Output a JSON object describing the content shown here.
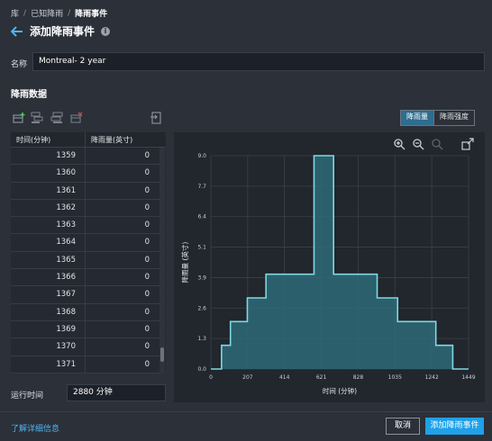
{
  "breadcrumb": [
    "库",
    "已知降雨",
    "降雨事件"
  ],
  "page_title": "添加降雨事件",
  "name_field": {
    "label": "名称",
    "value": "Montreal- 2 year"
  },
  "section_title": "降雨数据",
  "toggle": {
    "depth": "降雨量",
    "intensity": "降雨强度"
  },
  "table": {
    "headers": [
      "时间(分钟)",
      "降雨量(英寸)"
    ],
    "rows": [
      [
        "1359",
        "0"
      ],
      [
        "1360",
        "0"
      ],
      [
        "1361",
        "0"
      ],
      [
        "1362",
        "0"
      ],
      [
        "1363",
        "0"
      ],
      [
        "1364",
        "0"
      ],
      [
        "1365",
        "0"
      ],
      [
        "1366",
        "0"
      ],
      [
        "1367",
        "0"
      ],
      [
        "1368",
        "0"
      ],
      [
        "1369",
        "0"
      ],
      [
        "1370",
        "0"
      ],
      [
        "1371",
        "0"
      ]
    ]
  },
  "runtime": {
    "label": "运行时间",
    "value": "2880 分钟"
  },
  "footer": {
    "learn_more": "了解详细信息",
    "cancel": "取消",
    "add": "添加降雨事件"
  },
  "colors": {
    "accent": "#1ea1e8",
    "series_line": "#7fd8e0",
    "series_fill": "#2e6a78"
  },
  "chart_data": {
    "type": "area",
    "title": "",
    "xlabel": "时间 (分钟)",
    "ylabel": "降雨量 (英寸)",
    "xlim": [
      0,
      1449
    ],
    "ylim": [
      0,
      9.0
    ],
    "x_ticks": [
      "0",
      "207",
      "414",
      "621",
      "828",
      "1035",
      "1242",
      "1449"
    ],
    "y_ticks": [
      "0.0",
      "1.3",
      "2.6",
      "3.9",
      "5.1",
      "6.4",
      "7.7",
      "9.0"
    ],
    "grid": true,
    "step_points": [
      [
        0,
        0
      ],
      [
        60,
        0
      ],
      [
        60,
        1.0
      ],
      [
        110,
        1.0
      ],
      [
        110,
        2.0
      ],
      [
        205,
        2.0
      ],
      [
        205,
        3.0
      ],
      [
        310,
        3.0
      ],
      [
        310,
        4.0
      ],
      [
        580,
        4.0
      ],
      [
        580,
        9.0
      ],
      [
        690,
        9.0
      ],
      [
        690,
        4.0
      ],
      [
        935,
        4.0
      ],
      [
        935,
        3.0
      ],
      [
        1050,
        3.0
      ],
      [
        1050,
        2.0
      ],
      [
        1265,
        2.0
      ],
      [
        1265,
        1.0
      ],
      [
        1360,
        1.0
      ],
      [
        1360,
        0
      ],
      [
        1449,
        0
      ]
    ]
  }
}
